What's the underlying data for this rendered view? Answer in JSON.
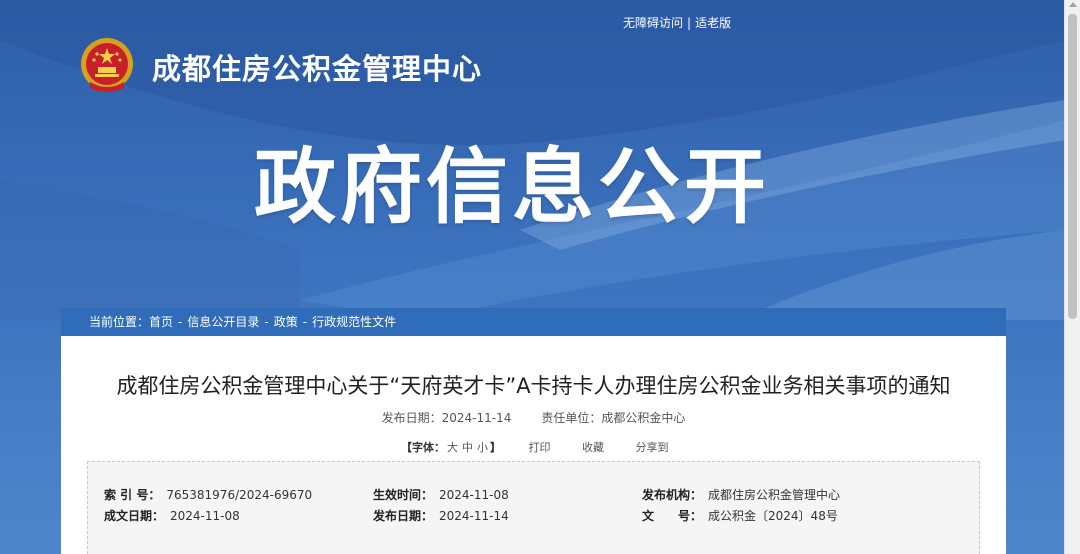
{
  "header": {
    "accessibility_link": "无障碍访问",
    "separator": "|",
    "elderly_link": "适老版",
    "org_name": "成都住房公积金管理中心",
    "emblem_icon": "national-emblem-icon",
    "hero_title": "政府信息公开"
  },
  "breadcrumb": {
    "prefix": "当前位置：",
    "items": [
      "首页",
      "信息公开目录",
      "政策",
      "行政规范性文件"
    ],
    "separator": "-"
  },
  "article": {
    "title": "成都住房公积金管理中心关于“天府英才卡”A卡持卡人办理住房公积金业务相关事项的通知",
    "publish_label": "发布日期：",
    "publish_date": "2024-11-14",
    "unit_label": "责任单位：",
    "unit": "成都公积金中心",
    "tools": {
      "font_open": "【字体：",
      "font_large": "大",
      "font_medium": "中",
      "font_small": "小",
      "font_close": "】",
      "print": "打印",
      "favorite": "收藏",
      "share": "分享到"
    }
  },
  "info": {
    "index_label": "索 引 号：",
    "index_value": "765381976/2024-69670",
    "effective_label": "生效时间：",
    "effective_value": "2024-11-08",
    "issuer_label": "发布机构：",
    "issuer_value": "成都住房公积金管理中心",
    "written_label": "成文日期：",
    "written_value": "2024-11-08",
    "pub_label": "发布日期：",
    "pub_value": "2024-11-14",
    "docno_label": "文　　号：",
    "docno_value": "成公积金〔2024〕48号"
  },
  "colors": {
    "header_blue": "#3b71bd",
    "breadcrumb_blue": "#2f6dbb",
    "info_background": "#f5f5f5"
  }
}
